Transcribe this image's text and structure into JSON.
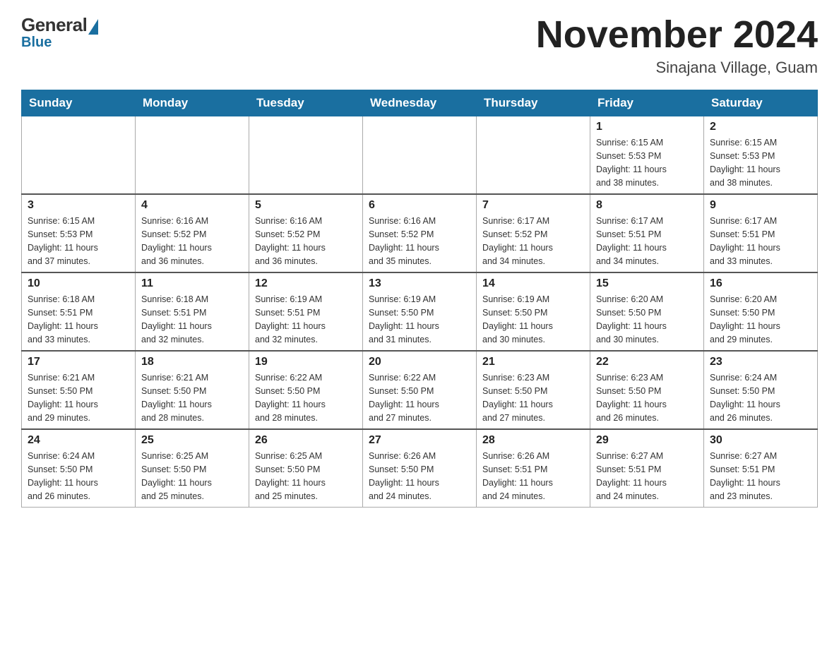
{
  "header": {
    "logo": {
      "general_text": "General",
      "blue_text": "Blue"
    },
    "title": "November 2024",
    "location": "Sinajana Village, Guam"
  },
  "days_of_week": [
    "Sunday",
    "Monday",
    "Tuesday",
    "Wednesday",
    "Thursday",
    "Friday",
    "Saturday"
  ],
  "weeks": [
    {
      "days": [
        {
          "date": "",
          "info": ""
        },
        {
          "date": "",
          "info": ""
        },
        {
          "date": "",
          "info": ""
        },
        {
          "date": "",
          "info": ""
        },
        {
          "date": "",
          "info": ""
        },
        {
          "date": "1",
          "info": "Sunrise: 6:15 AM\nSunset: 5:53 PM\nDaylight: 11 hours\nand 38 minutes."
        },
        {
          "date": "2",
          "info": "Sunrise: 6:15 AM\nSunset: 5:53 PM\nDaylight: 11 hours\nand 38 minutes."
        }
      ]
    },
    {
      "days": [
        {
          "date": "3",
          "info": "Sunrise: 6:15 AM\nSunset: 5:53 PM\nDaylight: 11 hours\nand 37 minutes."
        },
        {
          "date": "4",
          "info": "Sunrise: 6:16 AM\nSunset: 5:52 PM\nDaylight: 11 hours\nand 36 minutes."
        },
        {
          "date": "5",
          "info": "Sunrise: 6:16 AM\nSunset: 5:52 PM\nDaylight: 11 hours\nand 36 minutes."
        },
        {
          "date": "6",
          "info": "Sunrise: 6:16 AM\nSunset: 5:52 PM\nDaylight: 11 hours\nand 35 minutes."
        },
        {
          "date": "7",
          "info": "Sunrise: 6:17 AM\nSunset: 5:52 PM\nDaylight: 11 hours\nand 34 minutes."
        },
        {
          "date": "8",
          "info": "Sunrise: 6:17 AM\nSunset: 5:51 PM\nDaylight: 11 hours\nand 34 minutes."
        },
        {
          "date": "9",
          "info": "Sunrise: 6:17 AM\nSunset: 5:51 PM\nDaylight: 11 hours\nand 33 minutes."
        }
      ]
    },
    {
      "days": [
        {
          "date": "10",
          "info": "Sunrise: 6:18 AM\nSunset: 5:51 PM\nDaylight: 11 hours\nand 33 minutes."
        },
        {
          "date": "11",
          "info": "Sunrise: 6:18 AM\nSunset: 5:51 PM\nDaylight: 11 hours\nand 32 minutes."
        },
        {
          "date": "12",
          "info": "Sunrise: 6:19 AM\nSunset: 5:51 PM\nDaylight: 11 hours\nand 32 minutes."
        },
        {
          "date": "13",
          "info": "Sunrise: 6:19 AM\nSunset: 5:50 PM\nDaylight: 11 hours\nand 31 minutes."
        },
        {
          "date": "14",
          "info": "Sunrise: 6:19 AM\nSunset: 5:50 PM\nDaylight: 11 hours\nand 30 minutes."
        },
        {
          "date": "15",
          "info": "Sunrise: 6:20 AM\nSunset: 5:50 PM\nDaylight: 11 hours\nand 30 minutes."
        },
        {
          "date": "16",
          "info": "Sunrise: 6:20 AM\nSunset: 5:50 PM\nDaylight: 11 hours\nand 29 minutes."
        }
      ]
    },
    {
      "days": [
        {
          "date": "17",
          "info": "Sunrise: 6:21 AM\nSunset: 5:50 PM\nDaylight: 11 hours\nand 29 minutes."
        },
        {
          "date": "18",
          "info": "Sunrise: 6:21 AM\nSunset: 5:50 PM\nDaylight: 11 hours\nand 28 minutes."
        },
        {
          "date": "19",
          "info": "Sunrise: 6:22 AM\nSunset: 5:50 PM\nDaylight: 11 hours\nand 28 minutes."
        },
        {
          "date": "20",
          "info": "Sunrise: 6:22 AM\nSunset: 5:50 PM\nDaylight: 11 hours\nand 27 minutes."
        },
        {
          "date": "21",
          "info": "Sunrise: 6:23 AM\nSunset: 5:50 PM\nDaylight: 11 hours\nand 27 minutes."
        },
        {
          "date": "22",
          "info": "Sunrise: 6:23 AM\nSunset: 5:50 PM\nDaylight: 11 hours\nand 26 minutes."
        },
        {
          "date": "23",
          "info": "Sunrise: 6:24 AM\nSunset: 5:50 PM\nDaylight: 11 hours\nand 26 minutes."
        }
      ]
    },
    {
      "days": [
        {
          "date": "24",
          "info": "Sunrise: 6:24 AM\nSunset: 5:50 PM\nDaylight: 11 hours\nand 26 minutes."
        },
        {
          "date": "25",
          "info": "Sunrise: 6:25 AM\nSunset: 5:50 PM\nDaylight: 11 hours\nand 25 minutes."
        },
        {
          "date": "26",
          "info": "Sunrise: 6:25 AM\nSunset: 5:50 PM\nDaylight: 11 hours\nand 25 minutes."
        },
        {
          "date": "27",
          "info": "Sunrise: 6:26 AM\nSunset: 5:50 PM\nDaylight: 11 hours\nand 24 minutes."
        },
        {
          "date": "28",
          "info": "Sunrise: 6:26 AM\nSunset: 5:51 PM\nDaylight: 11 hours\nand 24 minutes."
        },
        {
          "date": "29",
          "info": "Sunrise: 6:27 AM\nSunset: 5:51 PM\nDaylight: 11 hours\nand 24 minutes."
        },
        {
          "date": "30",
          "info": "Sunrise: 6:27 AM\nSunset: 5:51 PM\nDaylight: 11 hours\nand 23 minutes."
        }
      ]
    }
  ]
}
